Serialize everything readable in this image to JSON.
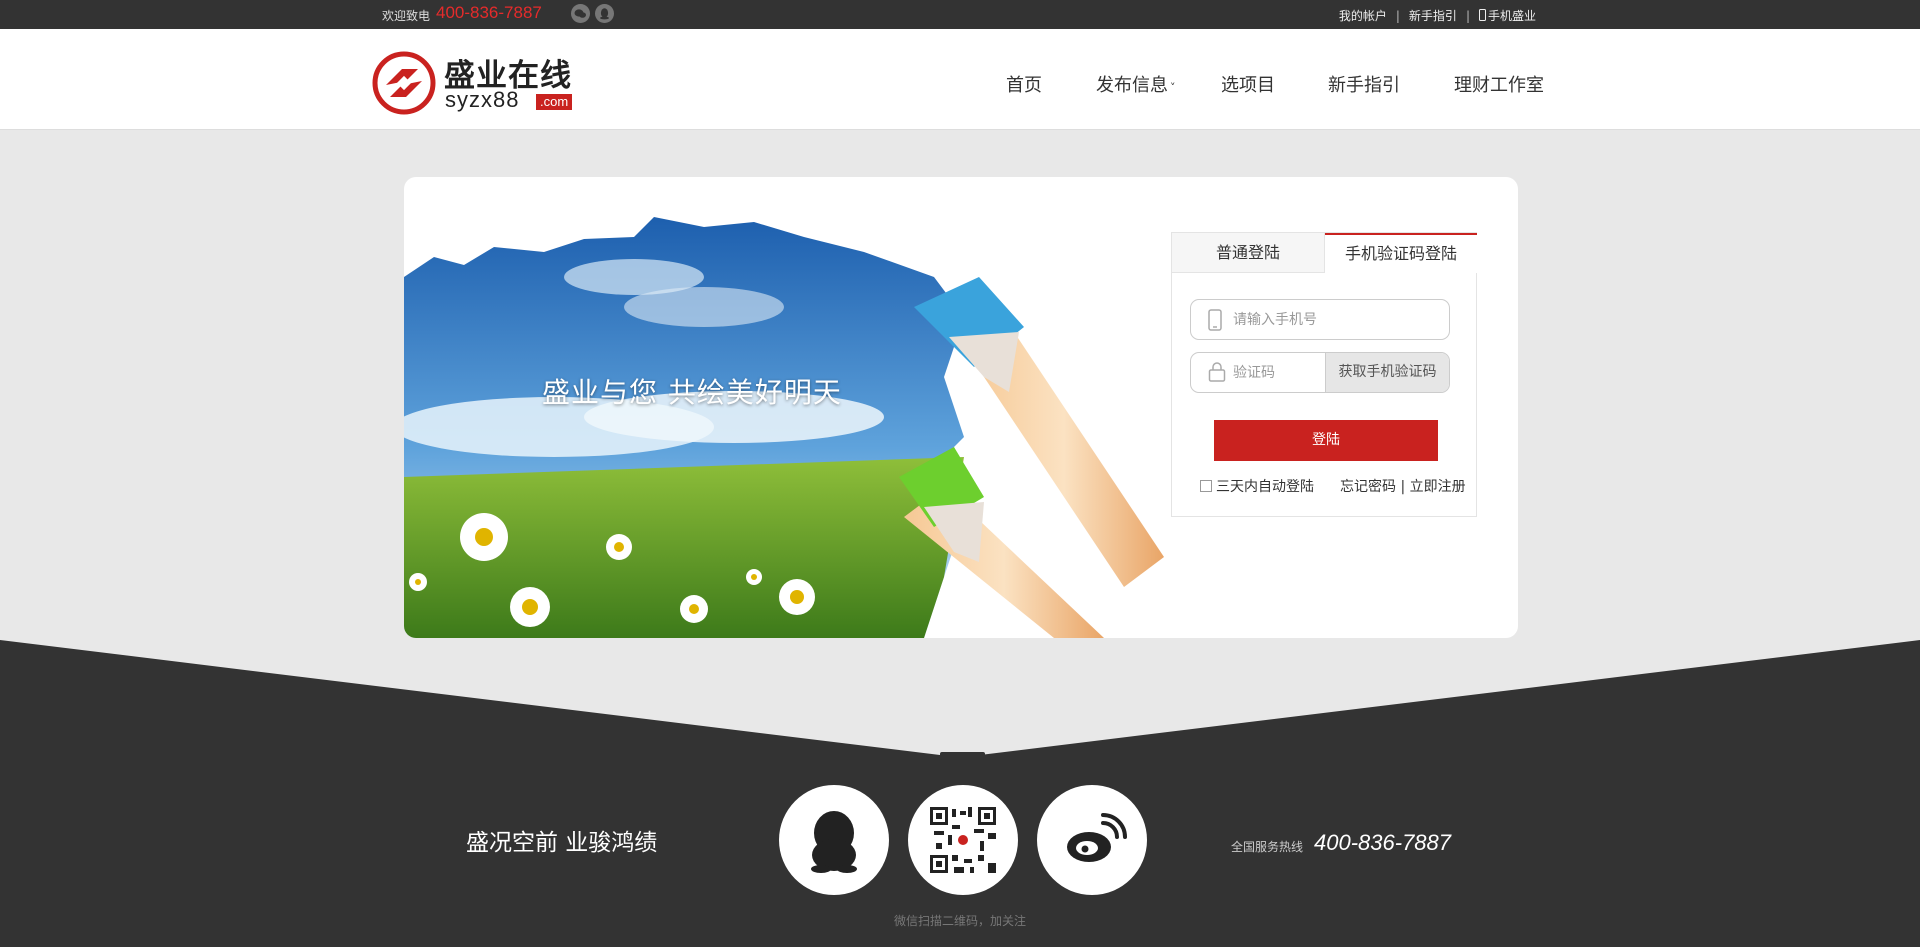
{
  "topbar": {
    "welcome": "欢迎致电",
    "phone": "400-836-7887",
    "links": [
      "我的帐户",
      "新手指引",
      "手机盛业"
    ],
    "sep": "|"
  },
  "logo": {
    "cn": "盛业在线",
    "en": "syzx88",
    "domain": ".com"
  },
  "nav": [
    {
      "label": "首页"
    },
    {
      "label": "发布信息",
      "caret": "˅"
    },
    {
      "label": "选项目"
    },
    {
      "label": "新手指引"
    },
    {
      "label": "理财工作室"
    }
  ],
  "banner": {
    "slogan": "盛业与您  共绘美好明天"
  },
  "login": {
    "tabs": [
      "普通登陆",
      "手机验证码登陆"
    ],
    "active_tab": 1,
    "phone_placeholder": "请输入手机号",
    "code_placeholder": "验证码",
    "get_code_label": "获取手机验证码",
    "submit_label": "登陆",
    "remember_label": "三天内自动登陆",
    "forgot_label": "忘记密码",
    "register_label": "立即注册",
    "sep": "|"
  },
  "footer": {
    "slogan": "盛况空前    业骏鸿绩",
    "hotline_label": "全国服务热线",
    "hotline": "400-836-7887",
    "wechat_note": "微信扫描二维码，加关注",
    "icons": [
      "qq-icon",
      "wechat-qrcode",
      "weibo-icon"
    ]
  },
  "colors": {
    "topbar_bg": "#333333",
    "accent_red": "#c9221f",
    "footer_bg": "#333333",
    "page_bg": "#e8e8e8"
  }
}
